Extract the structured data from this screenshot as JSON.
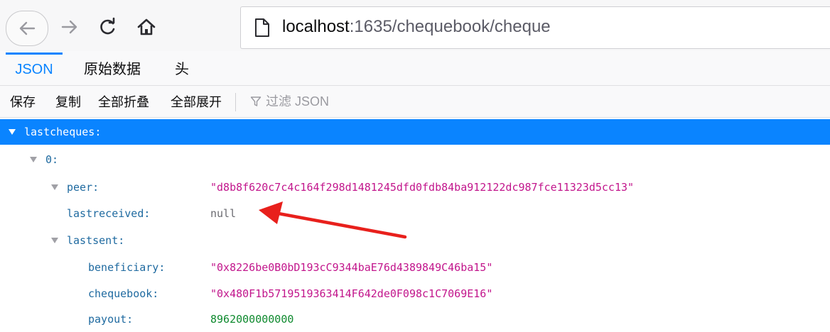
{
  "browser": {
    "url_host": "localhost",
    "url_rest": ":1635/chequebook/cheque",
    "icons": [
      "back-icon",
      "forward-icon",
      "reload-icon",
      "home-icon",
      "page-icon"
    ]
  },
  "viewer": {
    "tabs": [
      {
        "label": "JSON",
        "active": true
      },
      {
        "label": "原始数据",
        "active": false
      },
      {
        "label": "头",
        "active": false
      }
    ],
    "toolbar": {
      "save": "保存",
      "copy": "复制",
      "collapse_all": "全部折叠",
      "expand_all": "全部展开",
      "filter_placeholder": "过滤 JSON"
    }
  },
  "tree": {
    "root_key": "lastcheques:",
    "item_key": "0:",
    "peer_key": "peer:",
    "peer_value": "\"d8b8f620c7c4c164f298d1481245dfd0fdb84ba912122dc987fce11323d5cc13\"",
    "lastreceived_key": "lastreceived:",
    "lastreceived_value": "null",
    "lastsent_key": "lastsent:",
    "beneficiary_key": "beneficiary:",
    "beneficiary_value": "\"0x8226be0B0bD193cC9344baE76d4389849C46ba15\"",
    "chequebook_key": "chequebook:",
    "chequebook_value": "\"0x480F1b5719519363414F642de0F098c1C7069E16\"",
    "payout_key": "payout:",
    "payout_value": "8962000000000"
  },
  "colors": {
    "accent": "#0a84ff",
    "key": "#1f6aa0",
    "string": "#c2168c",
    "number": "#0f8a2f",
    "annotation_arrow": "#e8201c"
  }
}
